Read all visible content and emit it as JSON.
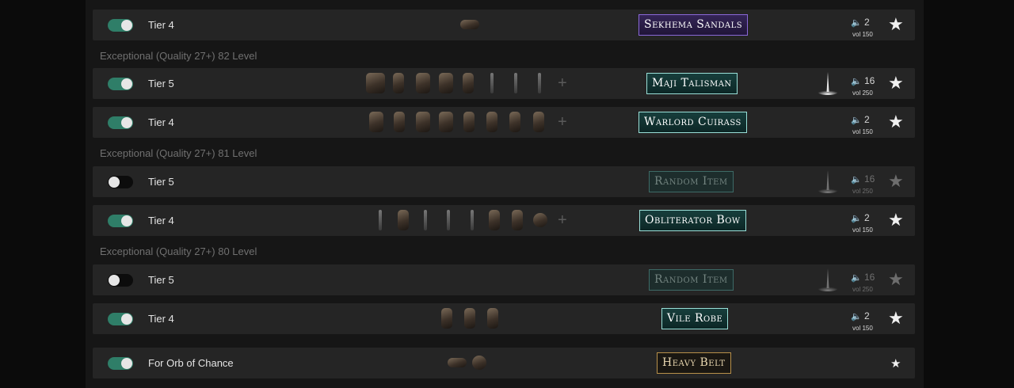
{
  "sections": [
    "Exceptional (Quality 27+) 82 Level",
    "Exceptional (Quality 27+) 81 Level",
    "Exceptional (Quality 27+) 80 Level"
  ],
  "rows": [
    {
      "enabled": true,
      "tier": "Tier 4",
      "label": "Sekhema Sandals",
      "sound_count": "2",
      "sound_volume": "vol 150"
    },
    {
      "enabled": true,
      "tier": "Tier 5",
      "label": "Maji Talisman",
      "sound_count": "16",
      "sound_volume": "vol 250"
    },
    {
      "enabled": true,
      "tier": "Tier 4",
      "label": "Warlord Cuirass",
      "sound_count": "2",
      "sound_volume": "vol 150"
    },
    {
      "enabled": false,
      "tier": "Tier 5",
      "label": "Random Item",
      "sound_count": "16",
      "sound_volume": "vol 250"
    },
    {
      "enabled": true,
      "tier": "Tier 4",
      "label": "Obliterator Bow",
      "sound_count": "2",
      "sound_volume": "vol 150"
    },
    {
      "enabled": false,
      "tier": "Tier 5",
      "label": "Random Item",
      "sound_count": "16",
      "sound_volume": "vol 250"
    },
    {
      "enabled": true,
      "tier": "Tier 4",
      "label": "Vile Robe",
      "sound_count": "2",
      "sound_volume": "vol 150"
    },
    {
      "enabled": true,
      "tier": "For Orb of Chance",
      "label": "Heavy Belt"
    }
  ],
  "icons": {
    "sound": "speaker-icon",
    "favorite": "star-icon",
    "add": "plus-icon",
    "beam": "light-beam-icon"
  },
  "colors": {
    "toggle_on": "#2f7e68",
    "toggle_off": "#0c0c0c",
    "label_purple": "#8a68d8",
    "label_teal": "#9ae0d8",
    "label_gold": "#b8904a"
  }
}
